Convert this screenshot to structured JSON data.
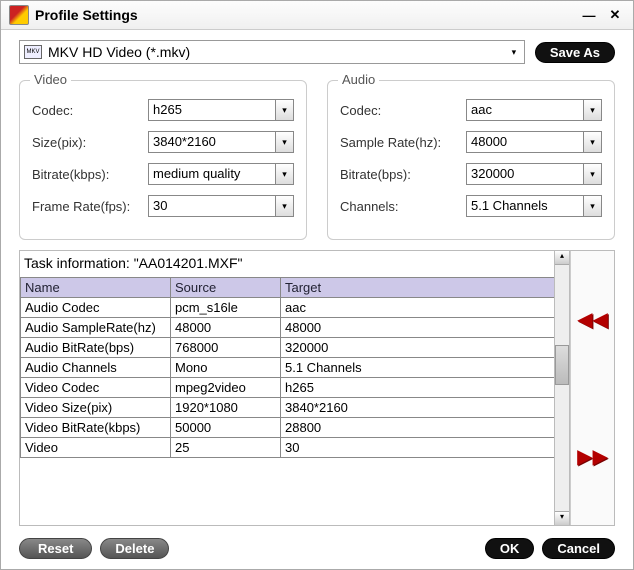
{
  "title": "Profile Settings",
  "profile": {
    "icon_label": "MKV",
    "value": "MKV HD Video (*.mkv)"
  },
  "buttons": {
    "saveas": "Save As",
    "reset": "Reset",
    "delete": "Delete",
    "ok": "OK",
    "cancel": "Cancel"
  },
  "video": {
    "legend": "Video",
    "codec_label": "Codec:",
    "codec_value": "h265",
    "size_label": "Size(pix):",
    "size_value": "3840*2160",
    "bitrate_label": "Bitrate(kbps):",
    "bitrate_value": "medium quality",
    "framerate_label": "Frame Rate(fps):",
    "framerate_value": "30"
  },
  "audio": {
    "legend": "Audio",
    "codec_label": "Codec:",
    "codec_value": "aac",
    "samplerate_label": "Sample Rate(hz):",
    "samplerate_value": "48000",
    "bitrate_label": "Bitrate(bps):",
    "bitrate_value": "320000",
    "channels_label": "Channels:",
    "channels_value": "5.1 Channels"
  },
  "task": {
    "header": "Task information: \"AA014201.MXF\"",
    "columns": [
      "Name",
      "Source",
      "Target"
    ],
    "rows": [
      [
        "Audio Codec",
        "pcm_s16le",
        "aac"
      ],
      [
        "Audio SampleRate(hz)",
        "48000",
        "48000"
      ],
      [
        "Audio BitRate(bps)",
        "768000",
        "320000"
      ],
      [
        "Audio Channels",
        "Mono",
        "5.1 Channels"
      ],
      [
        "Video Codec",
        "mpeg2video",
        "h265"
      ],
      [
        "Video Size(pix)",
        "1920*1080",
        "3840*2160"
      ],
      [
        "Video BitRate(kbps)",
        "50000",
        "28800"
      ],
      [
        "Video",
        "25",
        "30"
      ]
    ]
  }
}
